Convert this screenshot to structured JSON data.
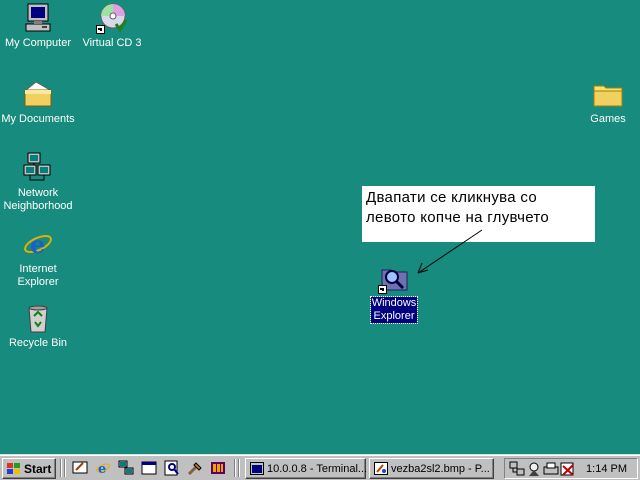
{
  "desktop": {
    "icons": {
      "my_computer": "My Computer",
      "virtual_cd": "Virtual CD 3",
      "my_documents": "My Documents",
      "network_line1": "Network",
      "network_line2": "Neighborhood",
      "ie_line1": "Internet",
      "ie_line2": "Explorer",
      "recycle_bin": "Recycle Bin",
      "games": "Games",
      "win_explorer_line1": "Windows",
      "win_explorer_line2": "Explorer"
    },
    "callout": {
      "line1": "Двапати се кликнува со",
      "line2": "левото копче на глувчето"
    }
  },
  "taskbar": {
    "start_label": "Start",
    "quick_launch": [
      "desktop-icon",
      "ie-icon",
      "network-icon",
      "window-icon",
      "search-icon",
      "tools-icon",
      "media-icon"
    ],
    "tasks": [
      {
        "label": "10.0.0.8 - Terminal...",
        "icon": "terminal-icon"
      },
      {
        "label": "vezba2sl2.bmp - P...",
        "icon": "paint-icon"
      }
    ],
    "clock": "1:14 PM"
  },
  "colors": {
    "desktop": "#178b7d",
    "taskbar": "#c0c0c0",
    "selection": "#000080"
  }
}
